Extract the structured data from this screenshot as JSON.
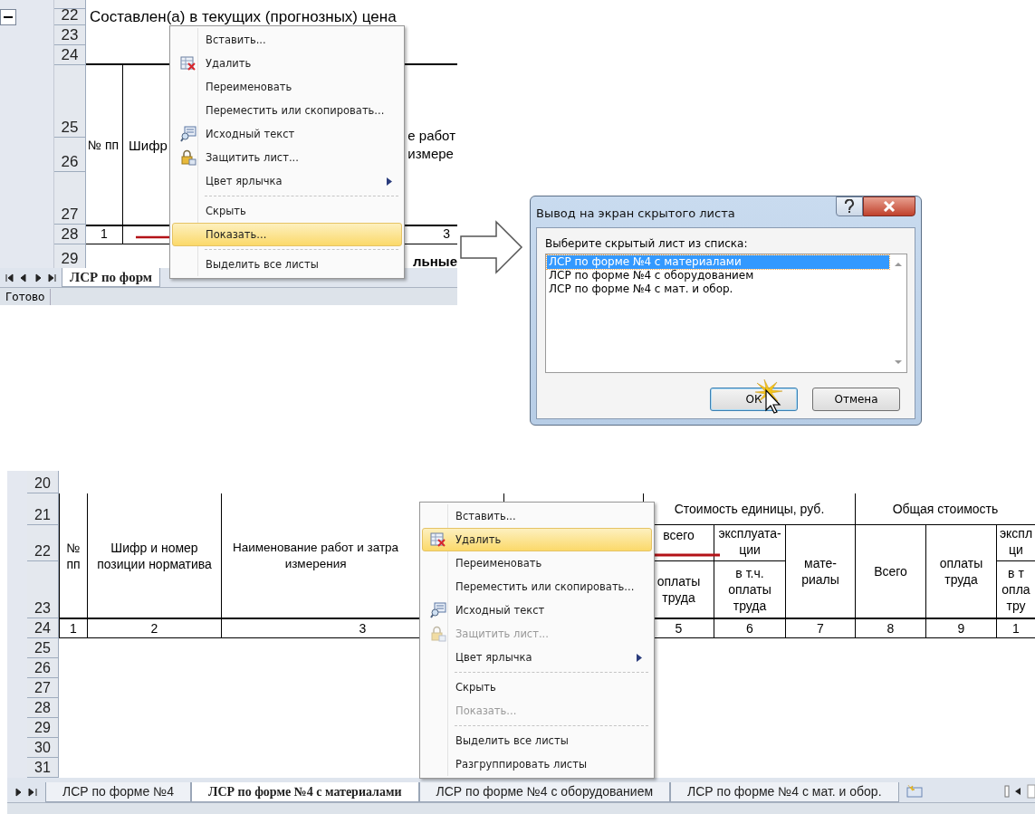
{
  "top_sheet": {
    "row_numbers": [
      "22",
      "23",
      "24",
      "25",
      "26",
      "27",
      "28",
      "29"
    ],
    "title_text": "Составлен(а) в текущих (прогнозных) цена",
    "header": {
      "number_col": "№ пп",
      "code_col": "Шифр",
      "name_col": [
        "е работ",
        "измере"
      ]
    },
    "index_row": [
      "1",
      "3"
    ],
    "row_29_text": "льные",
    "tabs": [
      {
        "label": "ЛСР по форм",
        "selected": true
      }
    ],
    "status": "Готово",
    "context_menu": [
      {
        "kind": "item",
        "label": "Вставить...",
        "highlighted": false,
        "disabled": false,
        "submenu": false
      },
      {
        "kind": "item",
        "label": "Удалить",
        "highlighted": false,
        "disabled": false,
        "submenu": false
      },
      {
        "kind": "item",
        "label": "Переименовать",
        "highlighted": false,
        "disabled": false,
        "submenu": false
      },
      {
        "kind": "item",
        "label": "Переместить или скопировать...",
        "highlighted": false,
        "disabled": false,
        "submenu": false
      },
      {
        "kind": "item",
        "label": "Исходный текст",
        "highlighted": false,
        "disabled": false,
        "submenu": false
      },
      {
        "kind": "item",
        "label": "Защитить лист...",
        "highlighted": false,
        "disabled": false,
        "submenu": false
      },
      {
        "kind": "item",
        "label": "Цвет ярлычка",
        "highlighted": false,
        "disabled": false,
        "submenu": true
      },
      {
        "kind": "separator"
      },
      {
        "kind": "item",
        "label": "Скрыть",
        "highlighted": false,
        "disabled": false,
        "submenu": false
      },
      {
        "kind": "item",
        "label": "Показать...",
        "highlighted": true,
        "disabled": false,
        "submenu": false
      },
      {
        "kind": "separator"
      },
      {
        "kind": "item",
        "label": "Выделить все листы",
        "highlighted": false,
        "disabled": false,
        "submenu": false
      }
    ]
  },
  "dialog": {
    "title": "Вывод на экран скрытого листа",
    "prompt": "Выберите скрытый лист из списка:",
    "sheets": [
      {
        "label": "ЛСР по форме №4 с материалами",
        "selected": true
      },
      {
        "label": "ЛСР по форме №4 с оборудованием",
        "selected": false
      },
      {
        "label": "ЛСР по форме №4 с мат. и обор.",
        "selected": false
      }
    ],
    "buttons": [
      "ОК",
      "Отмена"
    ]
  },
  "bottom_sheet": {
    "row_numbers": [
      "20",
      "21",
      "22",
      "23",
      "24",
      "25",
      "26",
      "27",
      "28",
      "29",
      "30",
      "31"
    ],
    "header": {
      "number_col": [
        "№",
        "пп"
      ],
      "code_col": [
        "Шифр и номер",
        "позиции норматива"
      ],
      "name_col": [
        "Наименование работ и затра",
        "измерения"
      ],
      "unit_cost": "Стоимость единицы, руб.",
      "unit_total": [
        "всего"
      ],
      "unit_labor": [
        "оплаты",
        "труда"
      ],
      "unit_machines": [
        "эксплуата-",
        "ции"
      ],
      "unit_machines_labor": [
        "в т.ч.",
        "оплаты",
        "труда"
      ],
      "unit_materials": [
        "мате-",
        "риалы"
      ],
      "total_cost": "Общая стоимость",
      "total_all": [
        "Всего"
      ],
      "total_labor": [
        "оплаты",
        "труда"
      ],
      "total_machines": [
        "экспл",
        "ци"
      ],
      "total_machines_labor": [
        "в т",
        "опла",
        "тру"
      ]
    },
    "index_row": [
      "1",
      "2",
      "3",
      "5",
      "6",
      "7",
      "8",
      "9",
      "1"
    ],
    "tabs": [
      {
        "label": "ЛСР по форме №4",
        "selected": false
      },
      {
        "label": "ЛСР по форме №4 с материалами",
        "selected": true
      },
      {
        "label": "ЛСР по форме №4 с оборудованием",
        "selected": false
      },
      {
        "label": "ЛСР по форме №4 с мат. и обор.",
        "selected": false
      }
    ],
    "context_menu": [
      {
        "kind": "item",
        "label": "Вставить...",
        "highlighted": false,
        "disabled": false,
        "submenu": false
      },
      {
        "kind": "item",
        "label": "Удалить",
        "highlighted": true,
        "disabled": false,
        "submenu": false
      },
      {
        "kind": "item",
        "label": "Переименовать",
        "highlighted": false,
        "disabled": false,
        "submenu": false
      },
      {
        "kind": "item",
        "label": "Переместить или скопировать...",
        "highlighted": false,
        "disabled": false,
        "submenu": false
      },
      {
        "kind": "item",
        "label": "Исходный текст",
        "highlighted": false,
        "disabled": false,
        "submenu": false
      },
      {
        "kind": "item",
        "label": "Защитить лист...",
        "highlighted": false,
        "disabled": true,
        "submenu": false
      },
      {
        "kind": "item",
        "label": "Цвет ярлычка",
        "highlighted": false,
        "disabled": false,
        "submenu": true
      },
      {
        "kind": "separator"
      },
      {
        "kind": "item",
        "label": "Скрыть",
        "highlighted": false,
        "disabled": false,
        "submenu": false
      },
      {
        "kind": "item",
        "label": "Показать...",
        "highlighted": false,
        "disabled": true,
        "submenu": false
      },
      {
        "kind": "separator"
      },
      {
        "kind": "item",
        "label": "Выделить все листы",
        "highlighted": false,
        "disabled": false,
        "submenu": false
      },
      {
        "kind": "item",
        "label": "Разгруппировать листы",
        "highlighted": false,
        "disabled": false,
        "submenu": false
      }
    ]
  }
}
